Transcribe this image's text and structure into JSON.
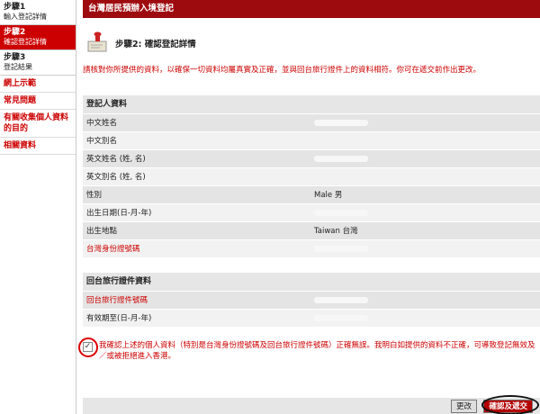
{
  "sidebar": {
    "steps": [
      {
        "title": "步驟1",
        "subtitle": "輸入登記詳情"
      },
      {
        "title": "步驟2",
        "subtitle": "確認登記詳情"
      },
      {
        "title": "步驟3",
        "subtitle": "登記結果"
      }
    ],
    "links": [
      "網上示範",
      "常見問題",
      "有關收集個人資料的目的",
      "相關資料"
    ]
  },
  "header": {
    "title": "台灣居民預辦入境登記"
  },
  "step_title": "步驟2: 確認登記詳情",
  "notice": "請核對你所提供的資料，以確保一切資料均屬真實及正確，並與回台旅行證件上的資料相符。你可在遞交前作出更改。",
  "registrant": {
    "heading": "登記人資料",
    "rows": [
      {
        "label": "中文姓名",
        "value": ""
      },
      {
        "label": "中文別名",
        "value": ""
      },
      {
        "label": "英文姓名 (姓, 名)",
        "value": ""
      },
      {
        "label": "英文別名 (姓, 名)",
        "value": ""
      },
      {
        "label": "性別",
        "value": "Male 男"
      },
      {
        "label": "出生日期(日-月-年)",
        "value": ""
      },
      {
        "label": "出生地點",
        "value": "Taiwan 台灣"
      },
      {
        "label": "台灣身份證號碼",
        "value": ""
      }
    ]
  },
  "travel_doc": {
    "heading": "回台旅行證件資料",
    "rows": [
      {
        "label": "回台旅行證件號碼",
        "value": ""
      },
      {
        "label": "有效期至(日-月-年)",
        "value": ""
      }
    ]
  },
  "confirm": {
    "checked": true,
    "text": "我確認上述的個人資料（特別是台灣身份證號碼及回台旅行證件號碼）正確無誤。我明白如提供的資料不正確，可導致登記無效及／或被拒絕進入香港。"
  },
  "buttons": {
    "edit": "更改",
    "submit": "確認及遞交"
  },
  "colors": {
    "brand": "#9e0b0f",
    "accent_red": "#cc0000"
  }
}
